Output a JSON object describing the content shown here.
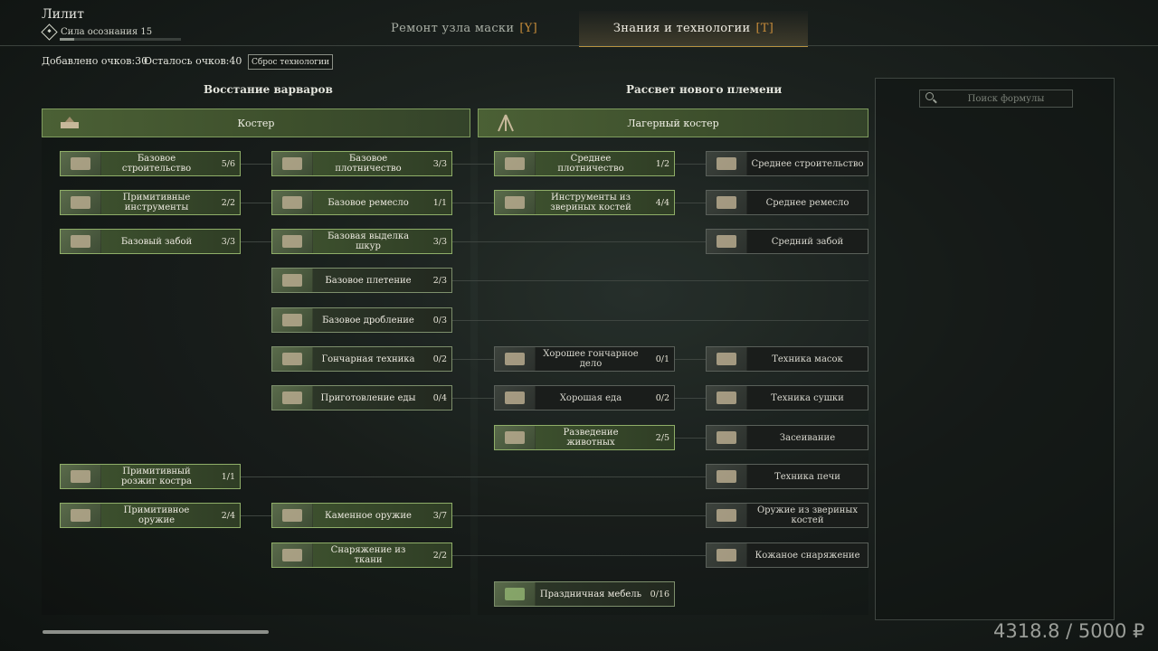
{
  "player": {
    "name": "Лилит",
    "awareness_label": "Сила осознания 15",
    "awareness_progress": 0.12
  },
  "tabs": [
    {
      "label": "Ремонт узла маски",
      "key": "[Y]",
      "active": false
    },
    {
      "label": "Знания и технологии",
      "key": "[T]",
      "active": true
    }
  ],
  "points": {
    "added": "Добавлено очков:30",
    "left": "Осталось очков:40",
    "reset_label": "Сброс технологии"
  },
  "sections": {
    "left": "Восстание варваров",
    "right": "Рассвет нового племени"
  },
  "roots": {
    "left": "Костер",
    "right": "Лагерный костер"
  },
  "nodes": {
    "n1": {
      "label": "Базовое строительство",
      "count": "5/6"
    },
    "n2": {
      "label": "Примитивные инструменты",
      "count": "2/2"
    },
    "n3": {
      "label": "Базовый забой",
      "count": "3/3"
    },
    "n4": {
      "label": "Базовое плотничество",
      "count": "3/3"
    },
    "n5": {
      "label": "Базовое ремесло",
      "count": "1/1"
    },
    "n6": {
      "label": "Базовая выделка шкур",
      "count": "3/3"
    },
    "n7": {
      "label": "Базовое плетение",
      "count": "2/3"
    },
    "n8": {
      "label": "Базовое дробление",
      "count": "0/3"
    },
    "n9": {
      "label": "Гончарная техника",
      "count": "0/2"
    },
    "n10": {
      "label": "Приготовление еды",
      "count": "0/4"
    },
    "n11": {
      "label": "Примитивный розжиг костра",
      "count": "1/1"
    },
    "n12": {
      "label": "Примитивное оружие",
      "count": "2/4"
    },
    "n13": {
      "label": "Каменное оружие",
      "count": "3/7"
    },
    "n14": {
      "label": "Снаряжение из ткани",
      "count": "2/2"
    },
    "n15": {
      "label": "Среднее плотничество",
      "count": "1/2"
    },
    "n16": {
      "label": "Инструменты из звериных костей",
      "count": "4/4"
    },
    "n17": {
      "label": "Хорошее гончарное дело",
      "count": "0/1"
    },
    "n18": {
      "label": "Хорошая еда",
      "count": "0/2"
    },
    "n19": {
      "label": "Разведение животных",
      "count": "2/5"
    },
    "n20": {
      "label": "Праздничная мебель",
      "count": "0/16"
    },
    "n21": {
      "label": "Среднее строительство",
      "count": ""
    },
    "n22": {
      "label": "Среднее ремесло",
      "count": ""
    },
    "n23": {
      "label": "Средний забой",
      "count": ""
    },
    "n24": {
      "label": "Техника масок",
      "count": ""
    },
    "n25": {
      "label": "Техника сушки",
      "count": ""
    },
    "n26": {
      "label": "Засеивание",
      "count": ""
    },
    "n27": {
      "label": "Техника печи",
      "count": ""
    },
    "n28": {
      "label": "Оружие из звериных костей",
      "count": ""
    },
    "n29": {
      "label": "Кожаное снаряжение",
      "count": ""
    }
  },
  "search": {
    "placeholder": "Поиск формулы"
  },
  "budget": "4318.8 / 5000 ₽"
}
